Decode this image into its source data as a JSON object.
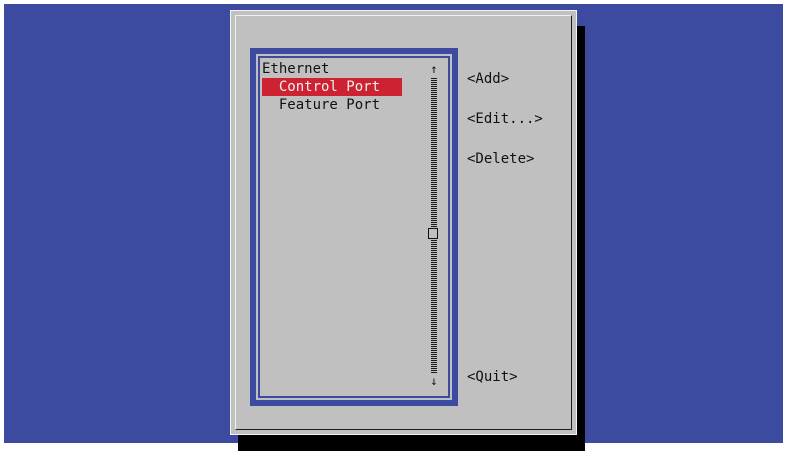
{
  "list": {
    "items": [
      {
        "label": "Ethernet"
      },
      {
        "label": "  Control Port",
        "selected": true
      },
      {
        "label": "  Feature Port"
      }
    ],
    "scroll_up": "↑",
    "scroll_down": "↓"
  },
  "buttons": {
    "add": "<Add>",
    "edit": "<Edit...>",
    "delete": "<Delete>",
    "quit": "<Quit>"
  },
  "colors": {
    "background": "#3c4aa0",
    "dialog": "#c0c0c0",
    "selection": "#cc2231"
  }
}
